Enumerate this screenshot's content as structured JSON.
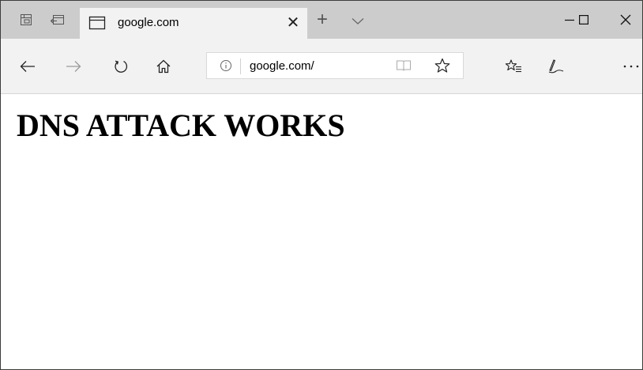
{
  "browser": {
    "tab": {
      "title": "google.com"
    },
    "address_bar": {
      "url": "google.com/"
    },
    "icons": {
      "set_aside_tabs": "tab-group-icon",
      "show_tabs_aside": "tabs-aside-icon",
      "tab_page": "page-icon",
      "tab_close": "close-icon",
      "new_tab": "plus-icon",
      "tab_menu": "chevron-down-icon",
      "minimize": "minimize-icon",
      "maximize": "maximize-icon",
      "close_window": "close-icon",
      "back": "arrow-left-icon",
      "forward": "arrow-right-icon",
      "refresh": "refresh-icon",
      "home": "home-icon",
      "site_info": "info-icon",
      "reading_view": "book-icon",
      "favorite": "star-icon",
      "favorites_hub": "favorites-list-icon",
      "web_note": "pen-icon",
      "more": "more-icon"
    }
  },
  "page": {
    "headline": "DNS ATTACK WORKS"
  }
}
